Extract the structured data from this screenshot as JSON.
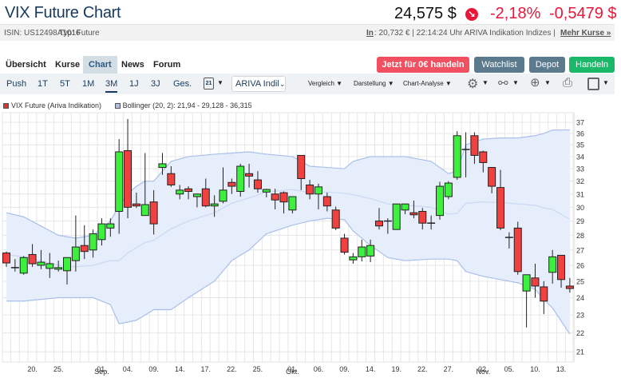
{
  "header": {
    "title": "VIX Future Chart",
    "price": "24,575 $",
    "change_pct": "-2,18%",
    "change_abs": "-0,5479 $",
    "trend_icon": "down-arrow-icon"
  },
  "info": {
    "isin": "ISIN: US12498A1016",
    "type": "Typ: Future",
    "in_label": "In",
    "quote": ": 20,732 € | 22:14:24 Uhr ARIVA Indikation Indizes |",
    "more": "Mehr Kurse »"
  },
  "nav": {
    "tabs": [
      "Übersicht",
      "Kurse",
      "Chart",
      "News",
      "Forum"
    ],
    "active": "Chart",
    "buttons": {
      "trade_free": "Jetzt für 0€ handeln",
      "watchlist": "Watchlist",
      "depot": "Depot",
      "trade": "Handeln"
    }
  },
  "toolbar": {
    "ranges": [
      "Push",
      "1T",
      "5T",
      "1M",
      "3M",
      "1J",
      "3J",
      "Ges."
    ],
    "active_range": "3M",
    "calendar_day": "21",
    "source": "ARIVA Indil",
    "menus": [
      "Vergleich",
      "Darstellung",
      "Chart-Analyse"
    ]
  },
  "colors": {
    "up": "#3ef03e",
    "down": "#f04040",
    "band": "#e6eefc",
    "band_line": "#a9bfea",
    "mid_line": "#c9d8f4",
    "accent_red": "#e8173a"
  },
  "chart_data": {
    "type": "candlestick",
    "legend": [
      {
        "label": "VIX Future (Ariva Indikation)",
        "color": "#e03030"
      },
      {
        "label": "Bollinger (20, 2): 21,94 - 29,128 - 36,315",
        "color": "#a9bfea"
      }
    ],
    "y_scale": "log",
    "ylim": [
      20.7,
      37.5
    ],
    "y_ticks": [
      21,
      22,
      23,
      24,
      25,
      26,
      27,
      28,
      29,
      30,
      31,
      32,
      33,
      34,
      35,
      36,
      37
    ],
    "x_labels": [
      {
        "i": 3,
        "t": "20."
      },
      {
        "i": 6,
        "t": "25."
      },
      {
        "i": 11,
        "t": "01.",
        "m": "Sep."
      },
      {
        "i": 14,
        "t": "04."
      },
      {
        "i": 17,
        "t": "09."
      },
      {
        "i": 20,
        "t": "14."
      },
      {
        "i": 23,
        "t": "17."
      },
      {
        "i": 26,
        "t": "22."
      },
      {
        "i": 29,
        "t": "25."
      },
      {
        "i": 33,
        "t": "01.",
        "m": "Okt."
      },
      {
        "i": 36,
        "t": "06."
      },
      {
        "i": 39,
        "t": "09."
      },
      {
        "i": 42,
        "t": "14."
      },
      {
        "i": 45,
        "t": "19."
      },
      {
        "i": 48,
        "t": "22."
      },
      {
        "i": 51,
        "t": "27."
      },
      {
        "i": 55,
        "t": "02.",
        "m": "Nov."
      },
      {
        "i": 58,
        "t": "05."
      },
      {
        "i": 61,
        "t": "10."
      },
      {
        "i": 64,
        "t": "13."
      }
    ],
    "ohlc": [
      [
        26.8,
        26.9,
        25.9,
        26.15
      ],
      [
        25.85,
        26.4,
        25.6,
        25.9
      ],
      [
        25.5,
        26.6,
        25.4,
        26.5
      ],
      [
        26.7,
        27.4,
        25.9,
        26.1
      ],
      [
        26.0,
        27.0,
        25.75,
        26.2
      ],
      [
        25.8,
        26.8,
        25.2,
        26.1
      ],
      [
        25.75,
        26.3,
        25.6,
        25.85
      ],
      [
        25.65,
        26.5,
        24.8,
        26.5
      ],
      [
        26.3,
        29.4,
        25.6,
        27.2
      ],
      [
        27.3,
        28.7,
        26.4,
        26.9
      ],
      [
        27.0,
        28.4,
        26.5,
        28.1
      ],
      [
        27.7,
        29.2,
        27.3,
        28.8
      ],
      [
        28.5,
        29.2,
        27.9,
        28.8
      ],
      [
        29.7,
        35.5,
        28.1,
        34.4
      ],
      [
        34.5,
        37.3,
        29.2,
        30.0
      ],
      [
        30.25,
        31.1,
        29.95,
        30.1
      ],
      [
        29.4,
        34.3,
        29.4,
        30.2
      ],
      [
        30.4,
        31.3,
        28.05,
        28.8
      ],
      [
        33.1,
        34.3,
        32.5,
        33.4
      ],
      [
        32.6,
        33.2,
        31.55,
        31.7
      ],
      [
        31.0,
        31.7,
        30.6,
        31.3
      ],
      [
        31.4,
        31.6,
        30.6,
        31.2
      ],
      [
        30.8,
        31.0,
        30.0,
        31.0
      ],
      [
        31.4,
        32.2,
        30.0,
        30.1
      ],
      [
        30.1,
        30.9,
        29.3,
        30.25
      ],
      [
        30.45,
        33.1,
        30.3,
        31.3
      ],
      [
        31.9,
        32.2,
        31.0,
        31.6
      ],
      [
        31.2,
        33.4,
        30.8,
        33.2
      ],
      [
        32.6,
        33.4,
        31.5,
        32.4
      ],
      [
        32.1,
        32.8,
        31.1,
        31.4
      ],
      [
        31.15,
        31.4,
        30.75,
        31.35
      ],
      [
        31.0,
        31.4,
        29.85,
        30.55
      ],
      [
        31.1,
        31.2,
        29.55,
        30.4
      ],
      [
        29.8,
        30.8,
        29.55,
        30.8
      ],
      [
        34.1,
        34.1,
        31.3,
        32.2
      ],
      [
        31.7,
        32.1,
        30.6,
        31.0
      ],
      [
        31.0,
        31.8,
        29.85,
        31.55
      ],
      [
        30.8,
        31.1,
        29.7,
        30.1
      ],
      [
        29.8,
        30.05,
        28.35,
        28.5
      ],
      [
        27.8,
        28.1,
        26.7,
        26.85
      ],
      [
        26.35,
        26.8,
        26.1,
        26.55
      ],
      [
        26.55,
        27.7,
        26.25,
        27.2
      ],
      [
        26.6,
        27.7,
        26.2,
        27.3
      ],
      [
        29.0,
        29.95,
        28.4,
        28.65
      ],
      [
        29.0,
        29.2,
        28.1,
        29.0
      ],
      [
        28.4,
        30.25,
        28.4,
        30.25
      ],
      [
        29.8,
        30.25,
        29.5,
        30.25
      ],
      [
        29.6,
        30.5,
        29.2,
        29.45
      ],
      [
        29.7,
        29.95,
        28.4,
        28.85
      ],
      [
        28.85,
        29.4,
        28.4,
        28.85
      ],
      [
        29.4,
        31.95,
        29.1,
        31.6
      ],
      [
        30.8,
        32.0,
        30.6,
        31.85
      ],
      [
        32.3,
        36.2,
        32.1,
        35.8
      ],
      [
        34.6,
        36.1,
        32.3,
        34.6
      ],
      [
        35.8,
        36.1,
        33.4,
        34.1
      ],
      [
        34.4,
        34.5,
        32.7,
        33.5
      ],
      [
        33.1,
        33.1,
        31.05,
        31.6
      ],
      [
        31.5,
        32.9,
        28.35,
        28.5
      ],
      [
        27.85,
        28.2,
        27.1,
        27.85
      ],
      [
        28.5,
        28.95,
        25.4,
        25.6
      ],
      [
        24.4,
        25.4,
        22.3,
        25.4
      ],
      [
        25.2,
        26.1,
        24.0,
        24.7
      ],
      [
        24.65,
        25.0,
        23.05,
        23.8
      ],
      [
        25.55,
        27.0,
        24.85,
        26.55
      ],
      [
        26.65,
        26.65,
        24.6,
        25.1
      ],
      [
        24.7,
        25.2,
        24.3,
        24.55
      ]
    ],
    "bollinger": [
      [
        0,
        23.8,
        29.6
      ],
      [
        2,
        23.8,
        29.3
      ],
      [
        6,
        24.0,
        28.0
      ],
      [
        8,
        24.0,
        27.8
      ],
      [
        10,
        24.0,
        28.0
      ],
      [
        12,
        23.6,
        29.0
      ],
      [
        13,
        22.5,
        30.1
      ],
      [
        14,
        22.6,
        31.0
      ],
      [
        15,
        22.7,
        31.6
      ],
      [
        16,
        23.0,
        32.0
      ],
      [
        17,
        23.3,
        32.0
      ],
      [
        18,
        23.3,
        32.8
      ],
      [
        19,
        23.3,
        33.6
      ],
      [
        21,
        24.0,
        34.0
      ],
      [
        24,
        25.0,
        34.2
      ],
      [
        26,
        26.3,
        34.3
      ],
      [
        28,
        27.0,
        34.4
      ],
      [
        30,
        28.1,
        34.2
      ],
      [
        33,
        28.7,
        34.0
      ],
      [
        35,
        29.0,
        33.2
      ],
      [
        37,
        29.2,
        33.1
      ],
      [
        39,
        29.1,
        33.0
      ],
      [
        40,
        28.3,
        33.6
      ],
      [
        42,
        27.3,
        34.0
      ],
      [
        44,
        26.5,
        34.0
      ],
      [
        46,
        26.3,
        34.0
      ],
      [
        49,
        26.4,
        33.6
      ],
      [
        51,
        26.4,
        32.6
      ],
      [
        52,
        26.3,
        32.8
      ],
      [
        53,
        25.6,
        35.0
      ],
      [
        55,
        25.3,
        35.5
      ],
      [
        57,
        25.1,
        35.6
      ],
      [
        59,
        24.9,
        35.6
      ],
      [
        61,
        24.5,
        35.8
      ],
      [
        62,
        23.9,
        36.0
      ],
      [
        63,
        23.4,
        36.3
      ],
      [
        65,
        21.94,
        36.315
      ]
    ]
  }
}
